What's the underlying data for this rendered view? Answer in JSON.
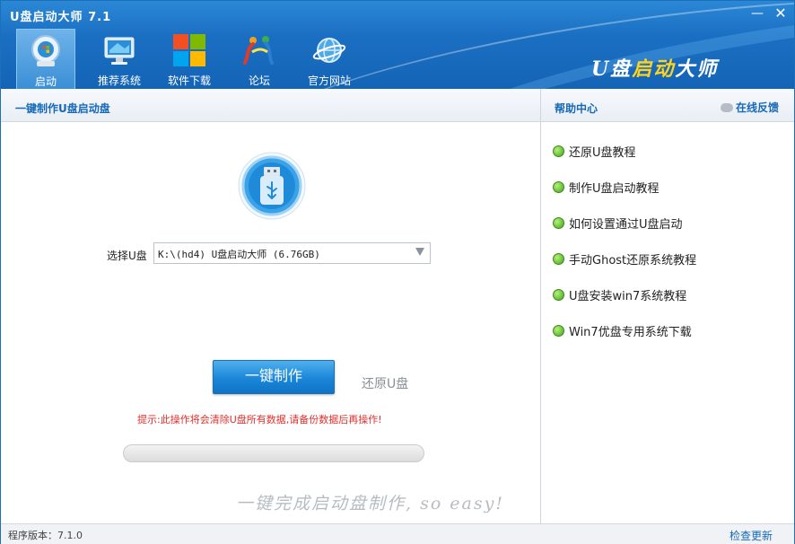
{
  "window": {
    "title": "U盘启动大师 7.1",
    "minimize_glyph": "—",
    "close_glyph": "✕"
  },
  "nav": [
    {
      "label": "启动",
      "icon": "startup-icon",
      "active": true
    },
    {
      "label": "推荐系统",
      "icon": "monitor-icon",
      "active": false
    },
    {
      "label": "软件下载",
      "icon": "windows-logo-icon",
      "active": false
    },
    {
      "label": "论坛",
      "icon": "people-icon",
      "active": false
    },
    {
      "label": "官方网站",
      "icon": "globe-icon",
      "active": false
    }
  ],
  "brand": {
    "part1": "U盘",
    "part2": "启动",
    "part3": "大师"
  },
  "left": {
    "header": "一键制作U盘启动盘",
    "select_label": "选择U盘",
    "select_value": "K:\\(hd4) U盘启动大师 (6.76GB)",
    "make_button": "一键制作",
    "restore_link": "还原U盘",
    "warning": "提示:此操作将会清除U盘所有数据,请备份数据后再操作!",
    "progress": 0,
    "slogan": "一键完成启动盘制作, so easy!"
  },
  "right": {
    "header": "帮助中心",
    "feedback": "在线反馈",
    "items": [
      "还原U盘教程",
      "制作U盘启动教程",
      "如何设置通过U盘启动",
      "手动Ghost还原系统教程",
      "U盘安装win7系统教程",
      "Win7优盘专用系统下载"
    ]
  },
  "status": {
    "version": "程序版本：7.1.0",
    "update": "检查更新"
  },
  "colors": {
    "header_blue": "#1b6fc2",
    "link_blue": "#1569b8",
    "warning_red": "#e0302c",
    "bullet_green": "#3fa31a",
    "brand_yellow": "#ffd21f"
  }
}
